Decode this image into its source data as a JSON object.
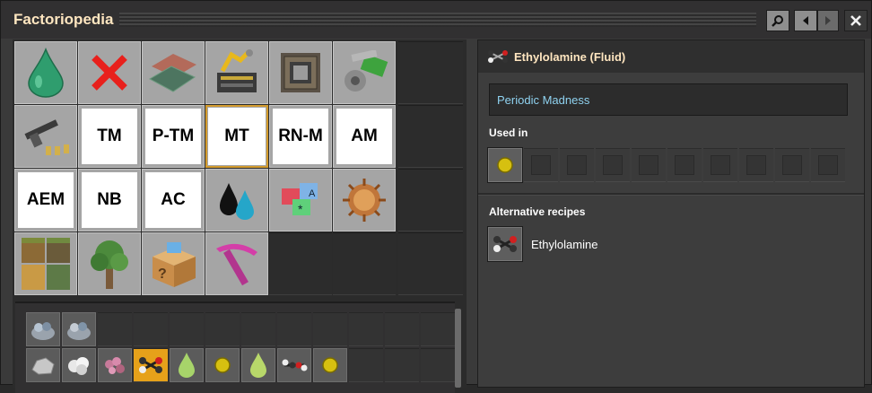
{
  "window": {
    "title": "Factoriopedia"
  },
  "titlebar": {
    "buttons": [
      {
        "icon": "search-icon"
      },
      {
        "icon": "arrow-left-icon"
      },
      {
        "icon": "arrow-right-icon"
      },
      {
        "icon": "close-icon"
      }
    ]
  },
  "categories": [
    {
      "icon": "fluid-drop-icon"
    },
    {
      "icon": "red-x-icon"
    },
    {
      "icon": "tiles-icon"
    },
    {
      "icon": "production-machine-icon"
    },
    {
      "icon": "circuit-machine-icon"
    },
    {
      "icon": "gear-circuit-icon"
    },
    {
      "icon": "weapons-icon"
    },
    {
      "label": "TM"
    },
    {
      "label": "P-TM"
    },
    {
      "label": "MT",
      "selected": true
    },
    {
      "label": "RN-M"
    },
    {
      "label": "AM"
    },
    {
      "label": "AEM"
    },
    {
      "label": "NB"
    },
    {
      "label": "AC"
    },
    {
      "icon": "two-drops-icon"
    },
    {
      "icon": "signals-icon"
    },
    {
      "icon": "spiky-creature-icon"
    },
    {
      "icon": "terrain-tiles-icon"
    },
    {
      "icon": "tree-icon"
    },
    {
      "icon": "unknown-box-icon"
    },
    {
      "icon": "pickaxe-icon"
    }
  ],
  "items": {
    "row1": [
      "ore-pile-icon",
      "ore-pile-icon"
    ],
    "row2": [
      "stone-icon",
      "white-rock-icon",
      "pink-crystal-icon",
      "ethylolamine-icon",
      "green-drop-icon",
      "yellow-ball-icon",
      "green-drop-icon",
      "molecule-icon",
      "yellow-ball-icon"
    ]
  },
  "detail": {
    "icon": "ethylolamine-icon",
    "title": "Ethylolamine (Fluid)",
    "mod": "Periodic Madness",
    "used_in_heading": "Used in",
    "used_in": [
      {
        "icon": "yellow-ball-icon"
      }
    ],
    "alt_heading": "Alternative recipes",
    "alternatives": [
      {
        "icon": "ethylolamine-icon",
        "label": "Ethylolamine"
      }
    ]
  },
  "colors": {
    "title": "#ffe6c0",
    "mod_text": "#8fd2f0",
    "selection": "#d39b2d",
    "highlight_slot": "#e6a11a"
  }
}
